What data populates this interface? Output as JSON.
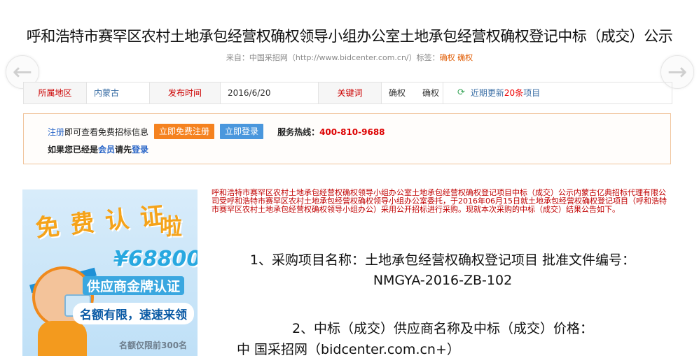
{
  "page": {
    "title": "呼和浩特市赛罕区农村土地承包经营权确权领导小组办公室土地承包经营权确权登记中标（成交）公示",
    "source_prefix": "来自：中国采招网（http://www.bidcenter.com.cn/）标签：",
    "source_tags": "确权 确权"
  },
  "nav": {
    "prev": "←",
    "next": "→"
  },
  "info": {
    "region_label": "所属地区",
    "region_value": "内蒙古",
    "date_label": "发布时间",
    "date_value": "2016/6/20",
    "keyword_label": "关键词",
    "keyword_value": "确权　　确权",
    "refresh_prefix": "近期更新",
    "refresh_count": "20条",
    "refresh_suffix": "项目"
  },
  "login": {
    "register_link": "注册",
    "register_text": "即可查看免费招标信息",
    "free_register_btn": "立即免费注册",
    "login_btn": "立即登录",
    "hotline_label": "服务热线：",
    "hotline_number": "400-810-9688",
    "member_prefix": "如果您已经是",
    "member_link": "会员",
    "member_mid": "请先",
    "login_link": "登录"
  },
  "ad": {
    "title_top": "免费认证",
    "title_end": "啦",
    "amount": "¥68800",
    "cert": "供应商金牌认证",
    "limit": "名额有限，速速来领",
    "quota": "名额仅限前300名"
  },
  "content": {
    "intro": "呼和浩特市赛罕区农村土地承包经营权确权领导小组办公室土地承包经营权确权登记项目中标（成交）公示内蒙古亿典招标代理有限公司受呼和浩特市赛罕区农村土地承包经营权确权领导小组办公室委托，于2016年06月15日就土地承包经营权确权登记项目（呼和浩特市赛罕区农村土地承包经营权确权领导小组办公）采用公开招标进行采购。现就本次采购的中标（成交）结果公告如下。",
    "item1_line1": "1、采购项目名称：土地承包经营权确权登记项目 批准文件编号：",
    "item1_line2": "NMGYA-2016-ZB-102",
    "item2": "2、中标（成交）供应商名称及中标（成交）价格：",
    "watermark": "中 国采招网（bidcenter.com.cn+）"
  }
}
